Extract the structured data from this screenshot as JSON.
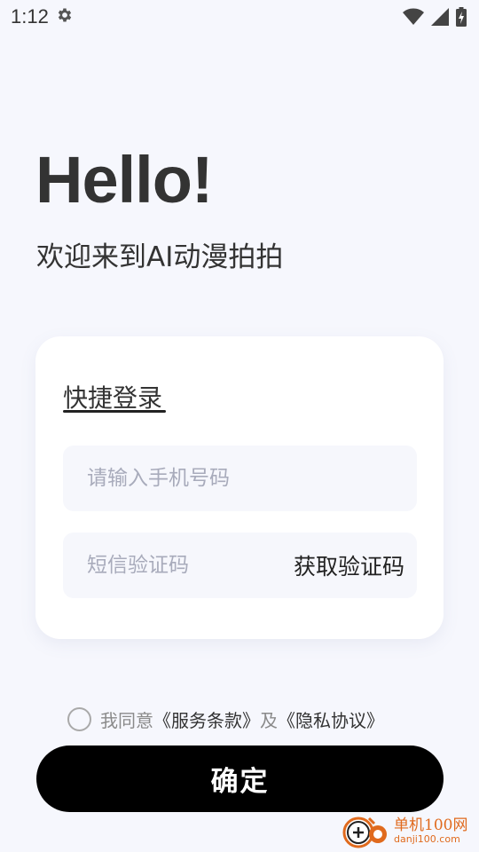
{
  "status_bar": {
    "time": "1:12",
    "icons": [
      "gear-icon",
      "wifi-icon",
      "signal-icon",
      "battery-icon"
    ]
  },
  "header": {
    "greeting": "Hello!",
    "welcome": "欢迎来到AI动漫拍拍"
  },
  "login_card": {
    "tab_label": "快捷登录",
    "phone_placeholder": "请输入手机号码",
    "code_placeholder": "短信验证码",
    "get_code_label": "获取验证码"
  },
  "agreement": {
    "prefix": "我同意",
    "terms_link": "《服务条款》",
    "and": "及",
    "privacy_link": "《隐私协议》",
    "checked": false
  },
  "confirm_label": "确定",
  "watermark": {
    "name": "单机100网",
    "url": "danji100.com"
  },
  "colors": {
    "background": "#f6f7fd",
    "card": "#ffffff",
    "field": "#f6f7fc",
    "button": "#000000",
    "watermark": "#e06a1d"
  }
}
